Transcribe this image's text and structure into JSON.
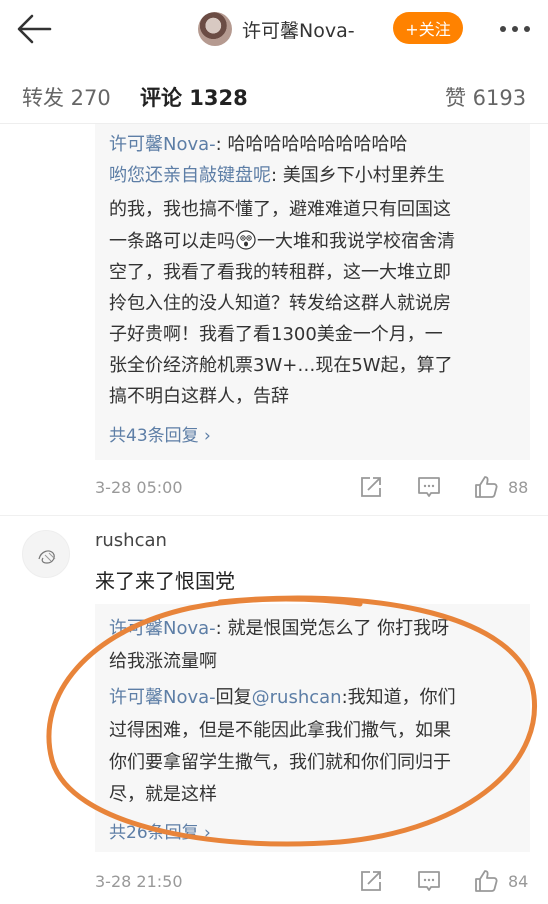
{
  "header": {
    "nickname": "许可馨Nova-",
    "follow_label": "+关注"
  },
  "tabs": [
    {
      "label": "转发 270"
    },
    {
      "label": "评论 1328"
    },
    {
      "label": "赞 6193"
    }
  ],
  "thread1": {
    "reply1": {
      "name": "许可馨Nova-",
      "text": ": 哈哈哈哈哈哈哈哈哈哈"
    },
    "reply2": {
      "name": "哟您还亲自敲键盘呢",
      "lines": [
        ": 美国乡下小村里养生",
        "的我，我也搞不懂了，避难难道只有回国这",
        "一条路可以走吗",
        "一大堆和我说学校宿舍清",
        "空了，我看了看我的转租群，这一大堆立即",
        "拎包入住的没人知道？转发给这群人就说房",
        "子好贵啊！我看了看1300美金一个月，一",
        "张全价经济舱机票3W+…现在5W起，算了",
        "搞不明白这群人，告辞"
      ]
    },
    "more_replies": "共43条回复 ›",
    "time": "3-28 05:00",
    "likes": "88"
  },
  "comment2": {
    "username": "rushcan",
    "text": "来了来了恨国党",
    "reply1": {
      "name": "许可馨Nova-",
      "lines": [
        ": 就是恨国党怎么了 你打我呀",
        "给我涨流量啊"
      ]
    },
    "reply2": {
      "name": "许可馨Nova-",
      "mid": "回复",
      "mention": "@rushcan",
      "lines": [
        ":我知道，你们",
        "过得困难，但是不能因此拿我们撒气，如果",
        "你们要拿留学生撒气，我们就和你们同归于",
        "尽，就是这样"
      ]
    },
    "more_replies": "共26条回复 ›",
    "time": "3-28 21:50",
    "likes": "84"
  },
  "colors": {
    "accent": "#ff8200",
    "link": "#5d7ea6",
    "annotation": "#e8843a"
  }
}
